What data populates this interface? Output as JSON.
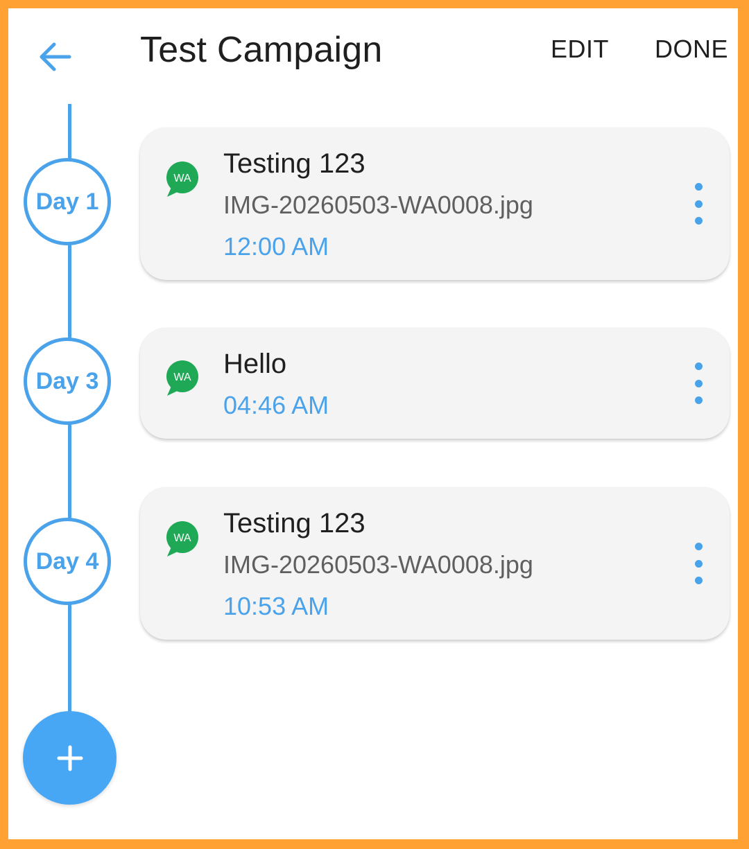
{
  "header": {
    "title": "Test Campaign",
    "back_icon": "arrow-left-icon",
    "edit_label": "EDIT",
    "done_label": "DONE"
  },
  "colors": {
    "accent": "#4aa3ea",
    "fab": "#47a7f5",
    "whatsapp_green": "#1fa855",
    "frame_border": "#ffa233",
    "card_background": "#f4f4f4"
  },
  "timeline": {
    "days": [
      {
        "label": "Day 1",
        "message": {
          "channel_badge": "WA",
          "title": "Testing 123",
          "attachment": "IMG-20260503-WA0008.jpg",
          "time": "12:00 AM"
        }
      },
      {
        "label": "Day 3",
        "message": {
          "channel_badge": "WA",
          "title": "Hello",
          "attachment": "",
          "time": "04:46 AM"
        }
      },
      {
        "label": "Day 4",
        "message": {
          "channel_badge": "WA",
          "title": "Testing 123",
          "attachment": "IMG-20260503-WA0008.jpg",
          "time": "10:53 AM"
        }
      }
    ],
    "add_button_icon": "plus-icon"
  }
}
